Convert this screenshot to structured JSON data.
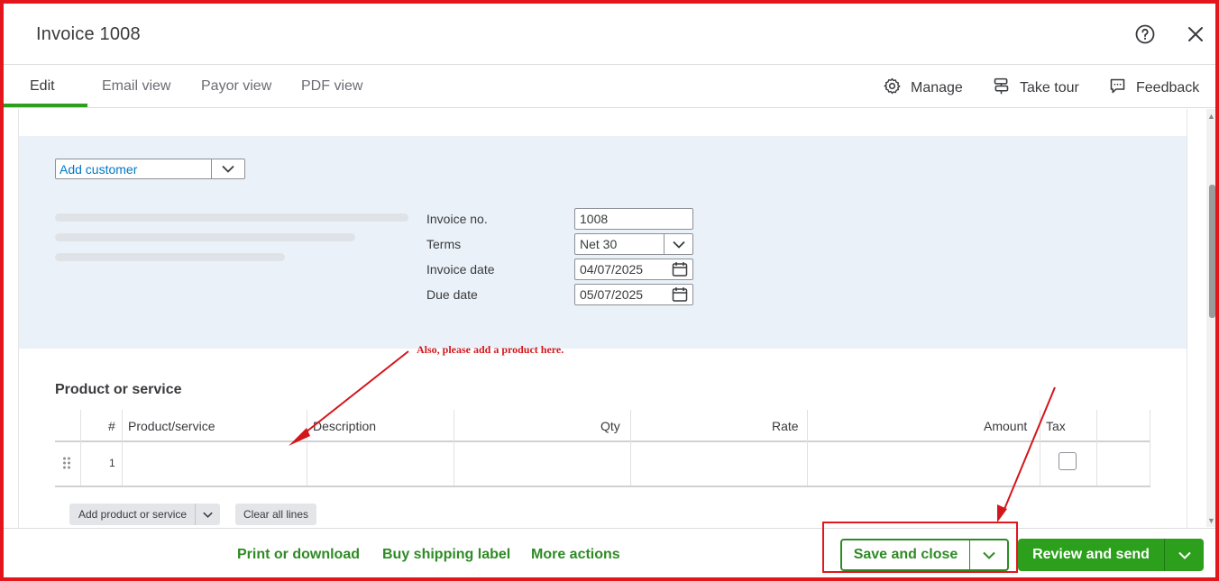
{
  "header": {
    "title": "Invoice 1008"
  },
  "tabs": [
    {
      "label": "Edit"
    },
    {
      "label": "Email view"
    },
    {
      "label": "Payor view"
    },
    {
      "label": "PDF view"
    }
  ],
  "tools": {
    "manage": "Manage",
    "take_tour": "Take tour",
    "feedback": "Feedback"
  },
  "customer": {
    "value": "Add customer"
  },
  "fields": {
    "invoice_no": {
      "label": "Invoice no.",
      "value": "1008"
    },
    "terms": {
      "label": "Terms",
      "value": "Net 30"
    },
    "invoice_date": {
      "label": "Invoice date",
      "value": "04/07/2025"
    },
    "due_date": {
      "label": "Due date",
      "value": "05/07/2025"
    }
  },
  "annotation": {
    "text": "Also, please add a product here.",
    "color": "#d3161b"
  },
  "products": {
    "title": "Product or service",
    "columns": {
      "num": "#",
      "product": "Product/service",
      "description": "Description",
      "qty": "Qty",
      "rate": "Rate",
      "amount": "Amount",
      "tax": "Tax"
    },
    "rows": [
      {
        "num": "1"
      }
    ]
  },
  "buttons": {
    "add_product": "Add product or service",
    "clear_lines": "Clear all lines"
  },
  "footer": {
    "print": "Print or download",
    "shipping": "Buy shipping label",
    "more": "More actions",
    "save_close": "Save and close",
    "review_send": "Review and send"
  },
  "colors": {
    "brand_green": "#2ca01c",
    "link_green": "#2e8b24",
    "highlight_red": "#e3161b",
    "customer_blue": "#0077c5"
  }
}
